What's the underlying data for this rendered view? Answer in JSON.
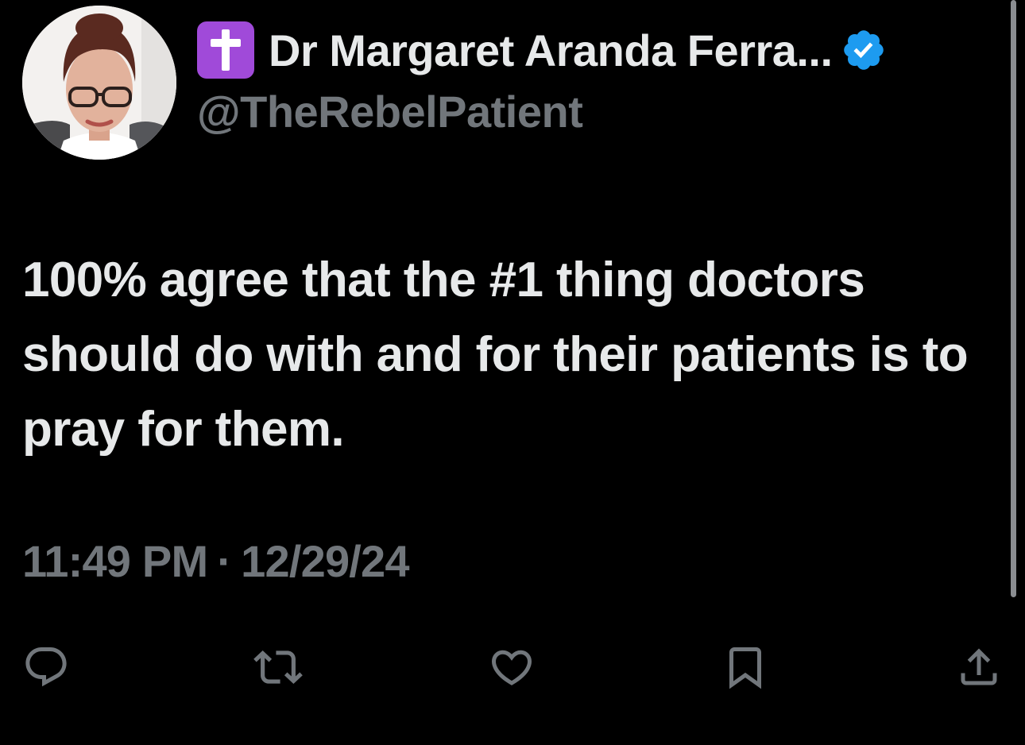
{
  "author": {
    "badge_emoji": "✝️",
    "display_name": "Dr Margaret Aranda Ferra...",
    "handle": "@TheRebelPatient",
    "verified": true
  },
  "tweet": {
    "text": "100% agree that the #1 thing doctors should do with and for their patients is to pray for them.",
    "time": "11:49 PM",
    "separator": "·",
    "date": "12/29/24"
  },
  "icons": {
    "avatar": "profile-photo",
    "badge": "latin-cross-icon",
    "verified": "verified-checkmark-icon",
    "reply": "reply-bubble-icon",
    "retweet": "retweet-icon",
    "like": "heart-icon",
    "bookmark": "bookmark-icon",
    "share": "share-upload-icon"
  },
  "colors": {
    "background": "#000000",
    "primary_text": "#e7e9ea",
    "secondary_text": "#71767b",
    "verified_blue": "#1d9bf0",
    "badge_purple": "#a04ad9"
  }
}
